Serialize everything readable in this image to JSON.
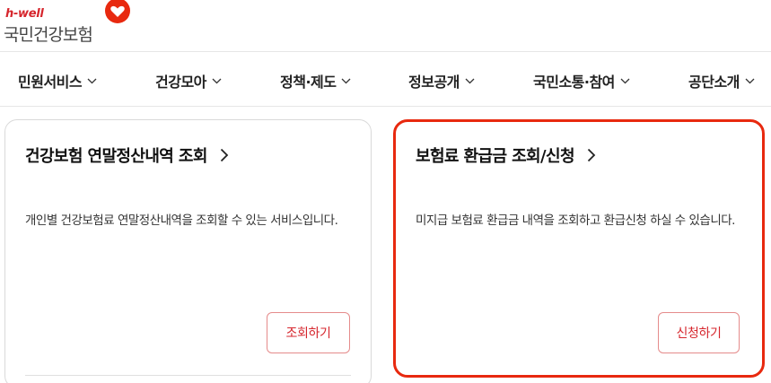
{
  "logo": {
    "brand": "h-well",
    "name": "국민건강보험",
    "heart_color": "#e8290f"
  },
  "nav": {
    "items": [
      {
        "label": "민원서비스"
      },
      {
        "label": "건강모아"
      },
      {
        "label": "정책·제도"
      },
      {
        "label": "정보공개"
      },
      {
        "label": "국민소통·참여"
      },
      {
        "label": "공단소개"
      }
    ]
  },
  "cards": [
    {
      "title": "건강보험 연말정산내역 조회",
      "description": "개인별 건강보험료 연말정산내역을 조회할 수 있는 서비스입니다.",
      "button": "조회하기"
    },
    {
      "title": "보험료 환급금 조회/신청",
      "description": "미지급 보험료 환급금 내역을 조회하고 환급신청 하실 수 있습니다.",
      "button": "신청하기",
      "highlight_color": "#e8290f"
    }
  ]
}
